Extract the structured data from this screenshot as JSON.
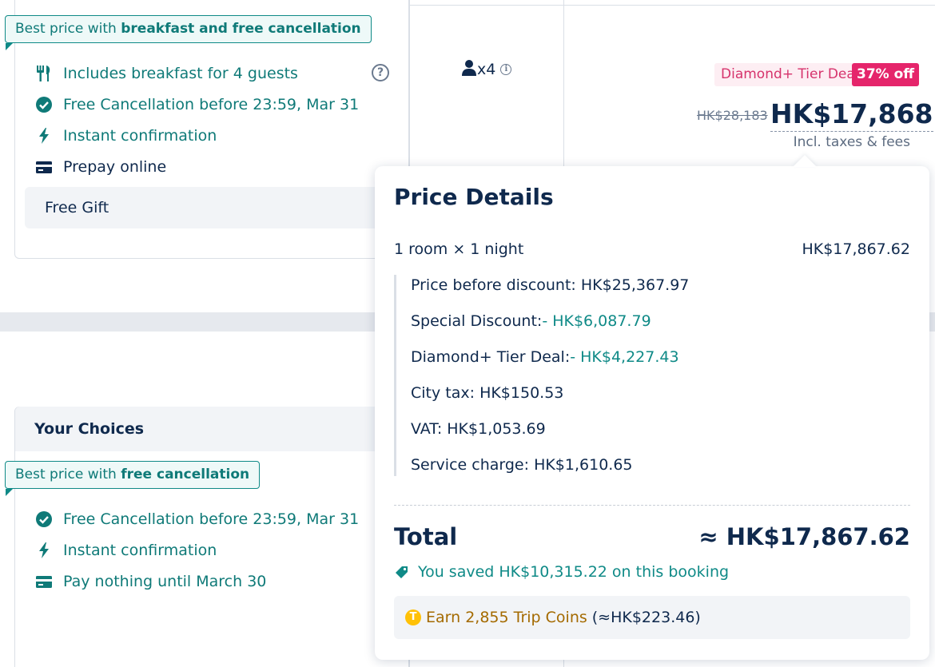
{
  "room1": {
    "ribbon_prefix": "Best price with ",
    "ribbon_bold": "breakfast and free cancellation",
    "features": [
      {
        "icon": "cutlery-icon",
        "text": "Includes breakfast for 4 guests"
      },
      {
        "icon": "check-circle-icon",
        "text": "Free Cancellation before 23:59, Mar 31"
      },
      {
        "icon": "lightning-icon",
        "text": "Instant confirmation"
      },
      {
        "icon": "credit-card-icon",
        "text": "Prepay online"
      }
    ],
    "gift": "Free Gift",
    "help_symbol": "?",
    "guests": "x4",
    "info_symbol": "i",
    "tier_deal": "Diamond+ Tier Deal",
    "discount_badge": "37% off",
    "old_price": "HK$28,183",
    "price": "HK$17,868",
    "price_note": "Incl. taxes & fees"
  },
  "room2": {
    "choices_title": "Your Choices",
    "ribbon_prefix": "Best price with ",
    "ribbon_bold": "free cancellation",
    "features": [
      {
        "icon": "check-circle-icon",
        "text": "Free Cancellation before 23:59, Mar 31"
      },
      {
        "icon": "lightning-icon",
        "text": "Instant confirmation"
      },
      {
        "icon": "credit-card-icon",
        "text": "Pay nothing until March 30"
      }
    ]
  },
  "price_details": {
    "title": "Price Details",
    "room_night_label": "1 room × 1 night",
    "room_night_value": "HK$17,867.62",
    "lines": [
      {
        "label": "Price before discount: ",
        "value": "HK$25,367.97",
        "teal": false
      },
      {
        "label": "Special Discount:",
        "value": "- HK$6,087.79",
        "teal": true
      },
      {
        "label": "Diamond+ Tier Deal:",
        "value": "- HK$4,227.43",
        "teal": true
      },
      {
        "label": "City tax: ",
        "value": "HK$150.53",
        "teal": false
      },
      {
        "label": "VAT: ",
        "value": "HK$1,053.69",
        "teal": false
      },
      {
        "label": "Service charge: ",
        "value": "HK$1,610.65",
        "teal": false
      }
    ],
    "total_label": "Total",
    "total_value": "≈ HK$17,867.62",
    "saved_text": "You saved HK$10,315.22 on this booking",
    "coin_symbol": "T",
    "coins_text": "Earn 2,855 Trip Coins",
    "coins_equiv": "(≈HK$223.46)"
  },
  "colors": {
    "teal": "#0f8a87",
    "navy": "#0f294d",
    "tier_pink": "#d6336c",
    "badge_pink": "#e5256b",
    "coin_gold": "#ffc107"
  }
}
